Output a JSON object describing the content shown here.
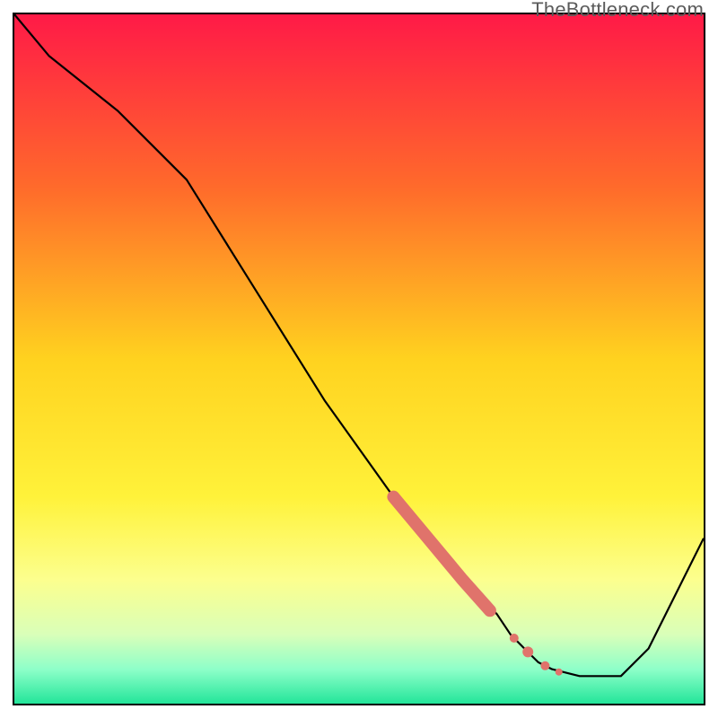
{
  "watermark": "TheBottleneck.com",
  "chart_data": {
    "type": "line",
    "title": "",
    "xlabel": "",
    "ylabel": "",
    "xlim": [
      0,
      100
    ],
    "ylim": [
      0,
      100
    ],
    "gradient_stops": [
      {
        "offset": 0,
        "color": "#ff1a47"
      },
      {
        "offset": 25,
        "color": "#ff6a2b"
      },
      {
        "offset": 50,
        "color": "#ffd21f"
      },
      {
        "offset": 70,
        "color": "#fff23a"
      },
      {
        "offset": 82,
        "color": "#fcff8e"
      },
      {
        "offset": 90,
        "color": "#d9ffb9"
      },
      {
        "offset": 95,
        "color": "#8effc9"
      },
      {
        "offset": 100,
        "color": "#23e59a"
      }
    ],
    "series": [
      {
        "name": "bottleneck-curve",
        "x": [
          0,
          5,
          15,
          25,
          35,
          45,
          55,
          60,
          65,
          70,
          72,
          74,
          76,
          78,
          82,
          88,
          92,
          96,
          100
        ],
        "y": [
          100,
          94,
          86,
          76,
          60,
          44,
          30,
          24,
          18,
          13,
          10,
          8,
          6,
          5,
          4,
          4,
          8,
          16,
          24
        ]
      }
    ],
    "highlights": [
      {
        "name": "thick-segment",
        "color": "#e0736b",
        "width": 14,
        "x": [
          55,
          60,
          65,
          69
        ],
        "y": [
          30,
          24,
          18,
          13.5
        ]
      }
    ],
    "points": [
      {
        "name": "marker-1",
        "x": 72.5,
        "y": 9.5,
        "r": 5,
        "color": "#e0736b"
      },
      {
        "name": "marker-2",
        "x": 74.5,
        "y": 7.5,
        "r": 6,
        "color": "#e0736b"
      },
      {
        "name": "marker-3",
        "x": 77.0,
        "y": 5.5,
        "r": 5,
        "color": "#e0736b"
      },
      {
        "name": "marker-4",
        "x": 79.0,
        "y": 4.6,
        "r": 4,
        "color": "#e0736b"
      }
    ]
  }
}
